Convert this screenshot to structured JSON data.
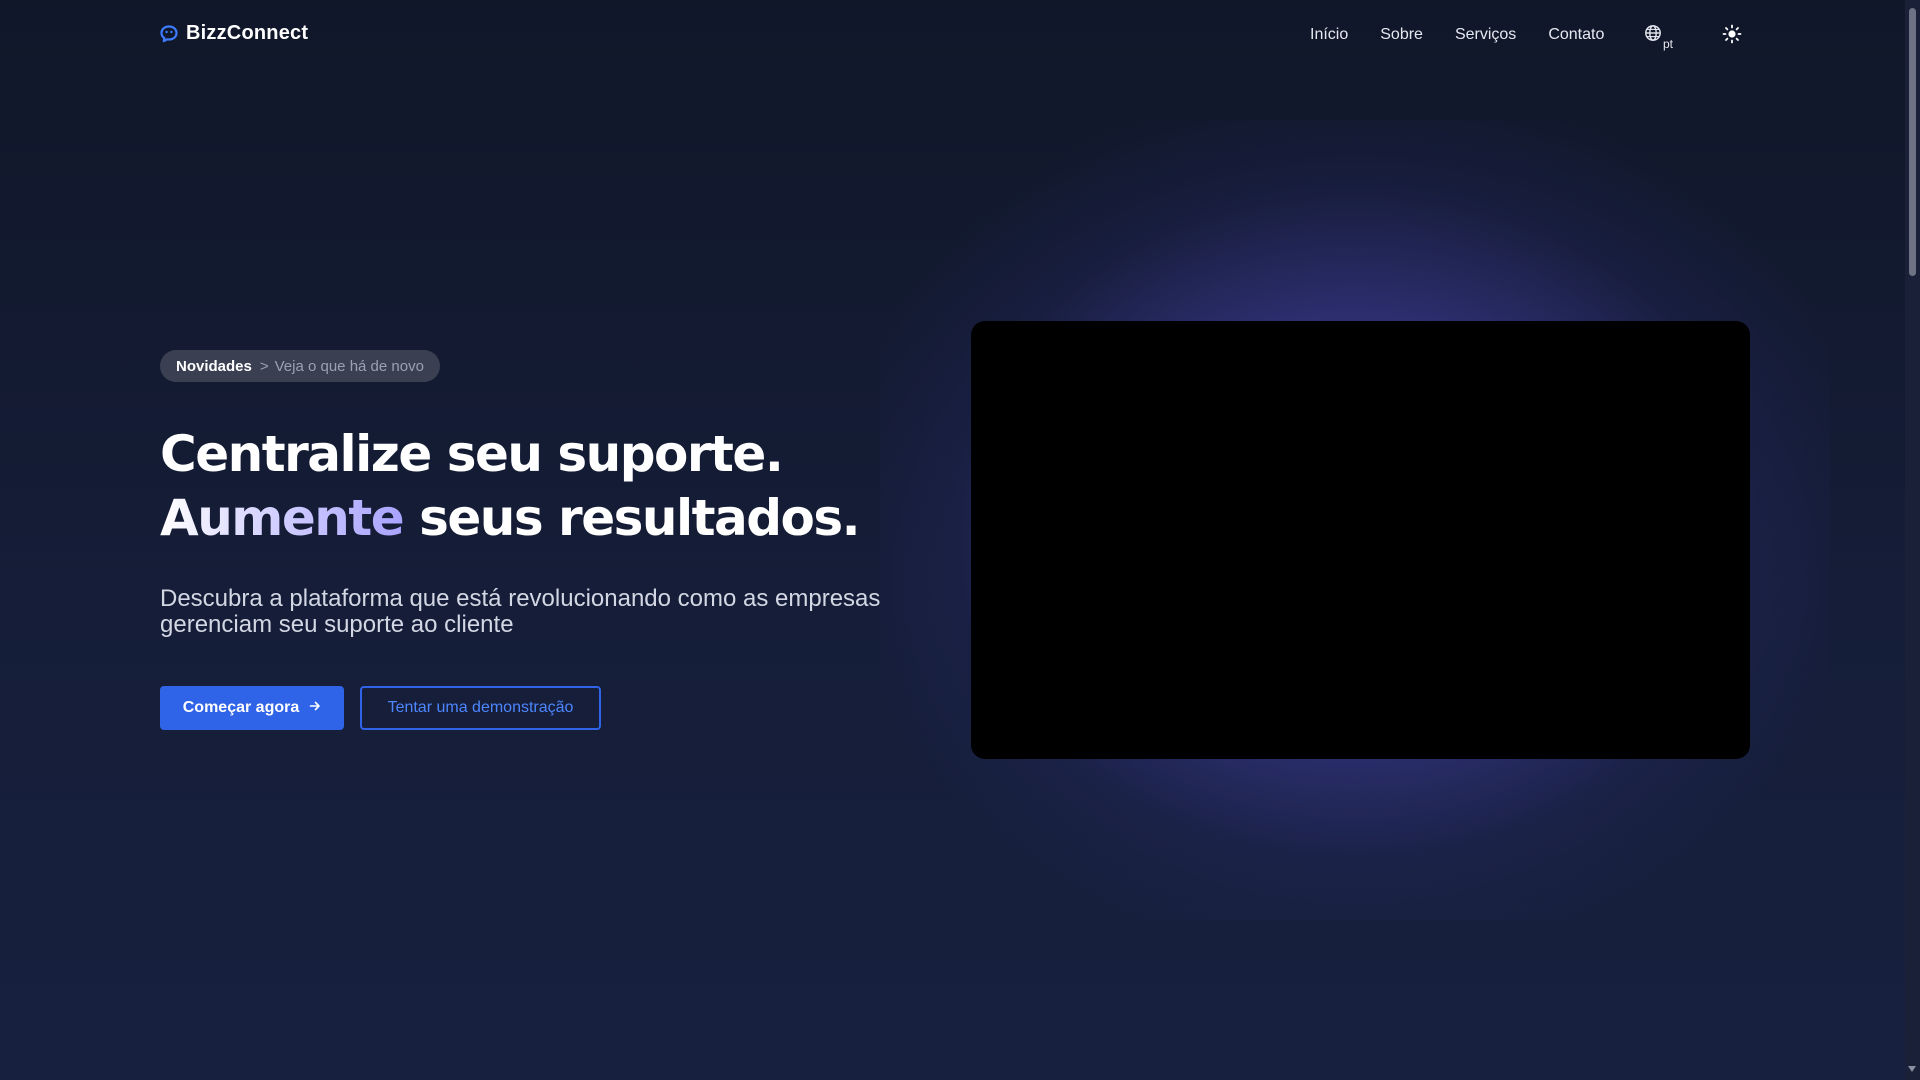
{
  "brand": {
    "name": "BizzConnect",
    "logo_icon": "chat-bubble-smile-icon"
  },
  "nav": {
    "items": [
      {
        "label": "Início"
      },
      {
        "label": "Sobre"
      },
      {
        "label": "Serviços"
      },
      {
        "label": "Contato"
      }
    ],
    "language": {
      "icon": "globe-icon",
      "code": "pt"
    },
    "theme_toggle_icon": "sun-icon"
  },
  "hero": {
    "badge": {
      "strong": "Novidades",
      "separator": ">",
      "text": "Veja o que há de novo"
    },
    "headline": {
      "part1": "Centralize seu suporte. ",
      "accent": "Aumente",
      "part2": " seus resultados."
    },
    "subtitle": "Descubra a plataforma que está revolucionando como as empresas gerenciam seu suporte ao cliente",
    "primary_cta": {
      "label": "Começar agora",
      "icon": "arrow-right-icon"
    },
    "secondary_cta": {
      "label": "Tentar uma demonstração"
    }
  },
  "colors": {
    "background": "#141a31",
    "accent_blue": "#2f63e8",
    "glow": "#6e64ff",
    "badge_bg": "#3a4052"
  }
}
